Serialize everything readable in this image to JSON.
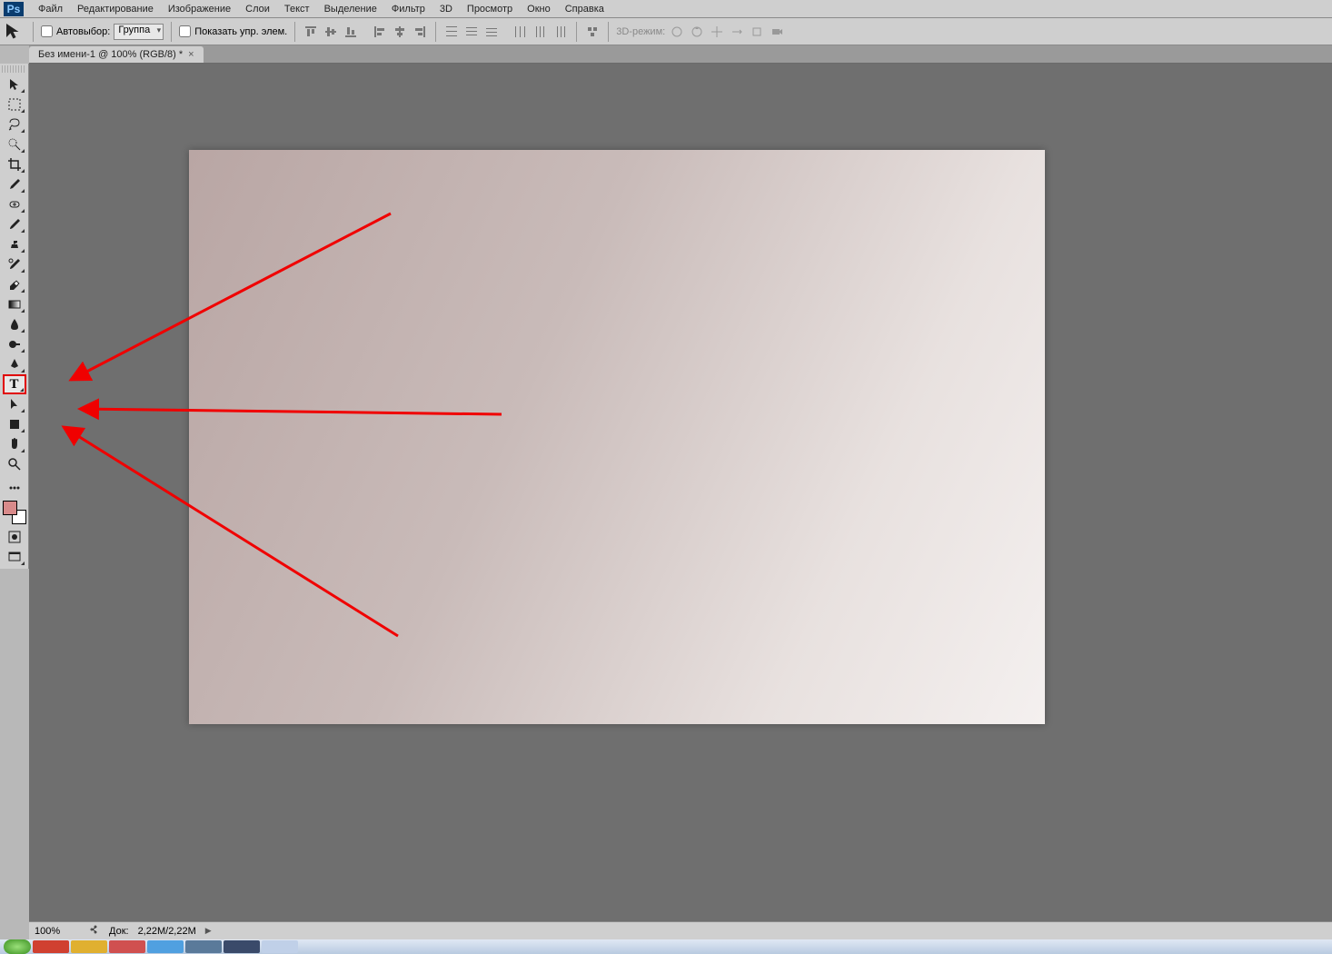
{
  "app": {
    "logo_text": "Ps"
  },
  "menu": {
    "items": [
      "Файл",
      "Редактирование",
      "Изображение",
      "Слои",
      "Текст",
      "Выделение",
      "Фильтр",
      "3D",
      "Просмотр",
      "Окно",
      "Справка"
    ]
  },
  "options": {
    "autoselect_label": "Автовыбор:",
    "autoselect_value": "Группа",
    "show_transform_label": "Показать упр. элем.",
    "mode3d_label": "3D-режим:"
  },
  "document": {
    "tab_title": "Без имени-1 @ 100% (RGB/8) *",
    "close_glyph": "×"
  },
  "toolbox": {
    "tools": [
      {
        "name": "move-tool"
      },
      {
        "name": "marquee-tool"
      },
      {
        "name": "lasso-tool"
      },
      {
        "name": "quick-select-tool"
      },
      {
        "name": "crop-tool"
      },
      {
        "name": "eyedropper-tool"
      },
      {
        "name": "healing-brush-tool"
      },
      {
        "name": "brush-tool"
      },
      {
        "name": "clone-stamp-tool"
      },
      {
        "name": "history-brush-tool"
      },
      {
        "name": "eraser-tool"
      },
      {
        "name": "gradient-tool"
      },
      {
        "name": "blur-tool"
      },
      {
        "name": "dodge-tool"
      },
      {
        "name": "pen-tool"
      },
      {
        "name": "type-tool",
        "selected": true,
        "glyph": "T"
      },
      {
        "name": "path-select-tool"
      },
      {
        "name": "shape-tool"
      },
      {
        "name": "hand-tool"
      },
      {
        "name": "zoom-tool"
      }
    ],
    "extra": [
      {
        "name": "default-colors-icon"
      },
      {
        "name": "quickmask-icon"
      },
      {
        "name": "screenmode-icon"
      }
    ]
  },
  "status": {
    "zoom": "100%",
    "doc_info_label": "Док:",
    "doc_info_value": "2,22M/2,22M",
    "arrow_glyph": "▶"
  },
  "colors": {
    "accent_red": "#f00000",
    "canvas_bg": "#6f6f6f",
    "chrome_bg": "#cfcfcf"
  }
}
